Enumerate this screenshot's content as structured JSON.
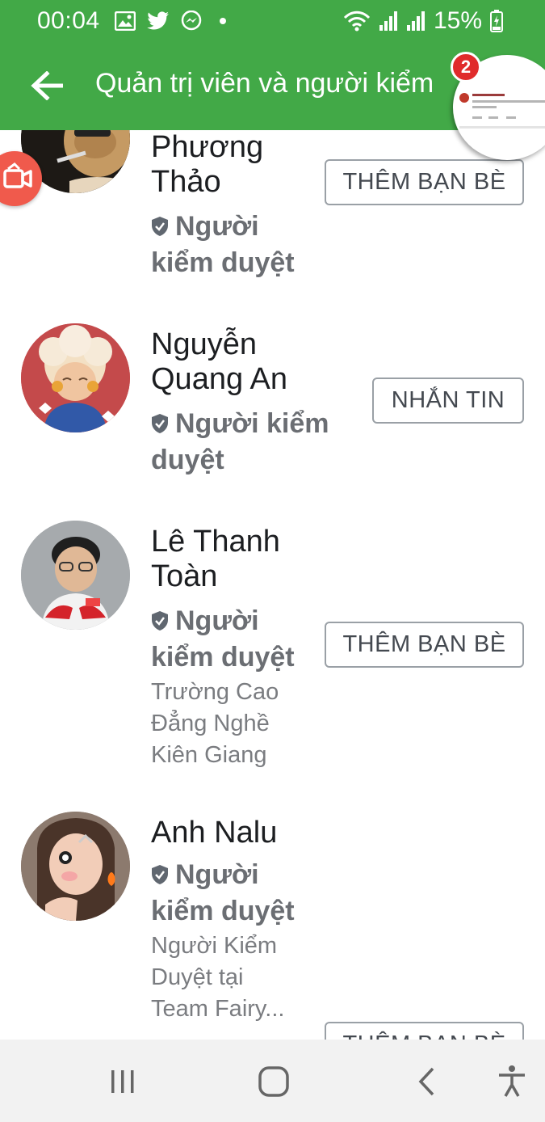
{
  "status_bar": {
    "time": "00:04",
    "battery": "15%"
  },
  "header": {
    "title": "Quản trị viên và người kiểm",
    "back_icon": "arrow-left-icon",
    "bg_color": "#42a947"
  },
  "chat_head": {
    "badge_count": "2"
  },
  "members": [
    {
      "name_lines": [
        "Phương",
        "Thảo"
      ],
      "role_lines": [
        "Người",
        "kiểm duyệt"
      ],
      "sub_lines": [],
      "button": "THÊM BẠN BÈ"
    },
    {
      "name_lines": [
        "Nguyễn",
        "Quang An"
      ],
      "role_lines": [
        "Người kiểm",
        "duyệt"
      ],
      "sub_lines": [],
      "button": "NHẮN TIN"
    },
    {
      "name_lines": [
        "Lê Thanh",
        "Toàn"
      ],
      "role_lines": [
        "Người",
        "kiểm duyệt"
      ],
      "sub_lines": [
        "Trường Cao",
        "Đẳng Nghề",
        "Kiên Giang"
      ],
      "button": "THÊM BẠN BÈ"
    },
    {
      "name_lines": [
        "Anh Nalu"
      ],
      "role_lines": [
        "Người",
        "kiểm duyệt"
      ],
      "sub_lines": [
        "Người Kiểm",
        "Duyệt tại",
        "Team Fairy..."
      ],
      "button": "THÊM BẠN BÈ"
    }
  ],
  "nav_bar": {
    "recents_icon": "recents-icon",
    "home_icon": "home-icon",
    "back_icon": "nav-back-icon",
    "accessibility_icon": "accessibility-icon"
  }
}
